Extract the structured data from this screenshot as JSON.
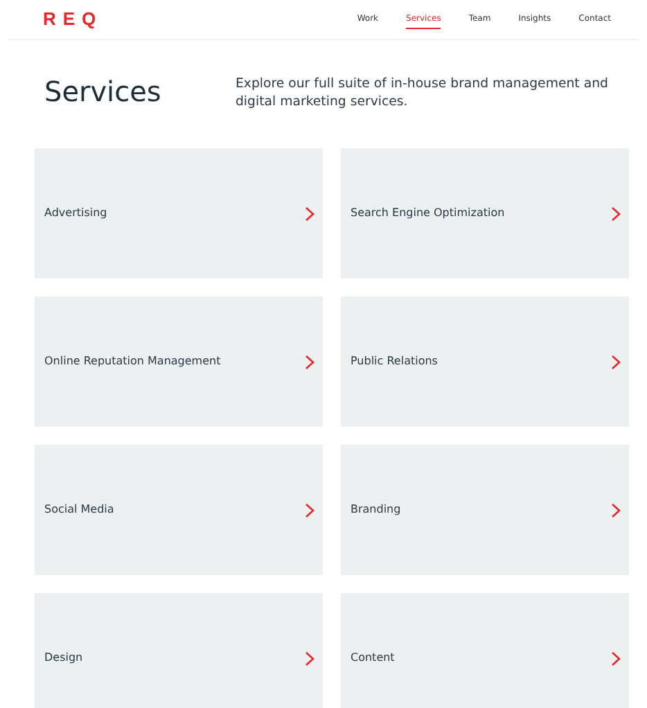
{
  "logo": "REQ",
  "nav": [
    {
      "label": "Work",
      "selected": false
    },
    {
      "label": "Services",
      "selected": true
    },
    {
      "label": "Team",
      "selected": false
    },
    {
      "label": "Insights",
      "selected": false
    },
    {
      "label": "Contact",
      "selected": false
    }
  ],
  "heading": "Services",
  "intro": "Explore our full suite of in-house brand management and digital marketing services.",
  "services": [
    {
      "label": "Advertising"
    },
    {
      "label": "Search Engine Optimization"
    },
    {
      "label": "Online Reputation Management"
    },
    {
      "label": "Public Relations"
    },
    {
      "label": "Social Media"
    },
    {
      "label": "Branding"
    },
    {
      "label": "Design"
    },
    {
      "label": "Content"
    }
  ]
}
